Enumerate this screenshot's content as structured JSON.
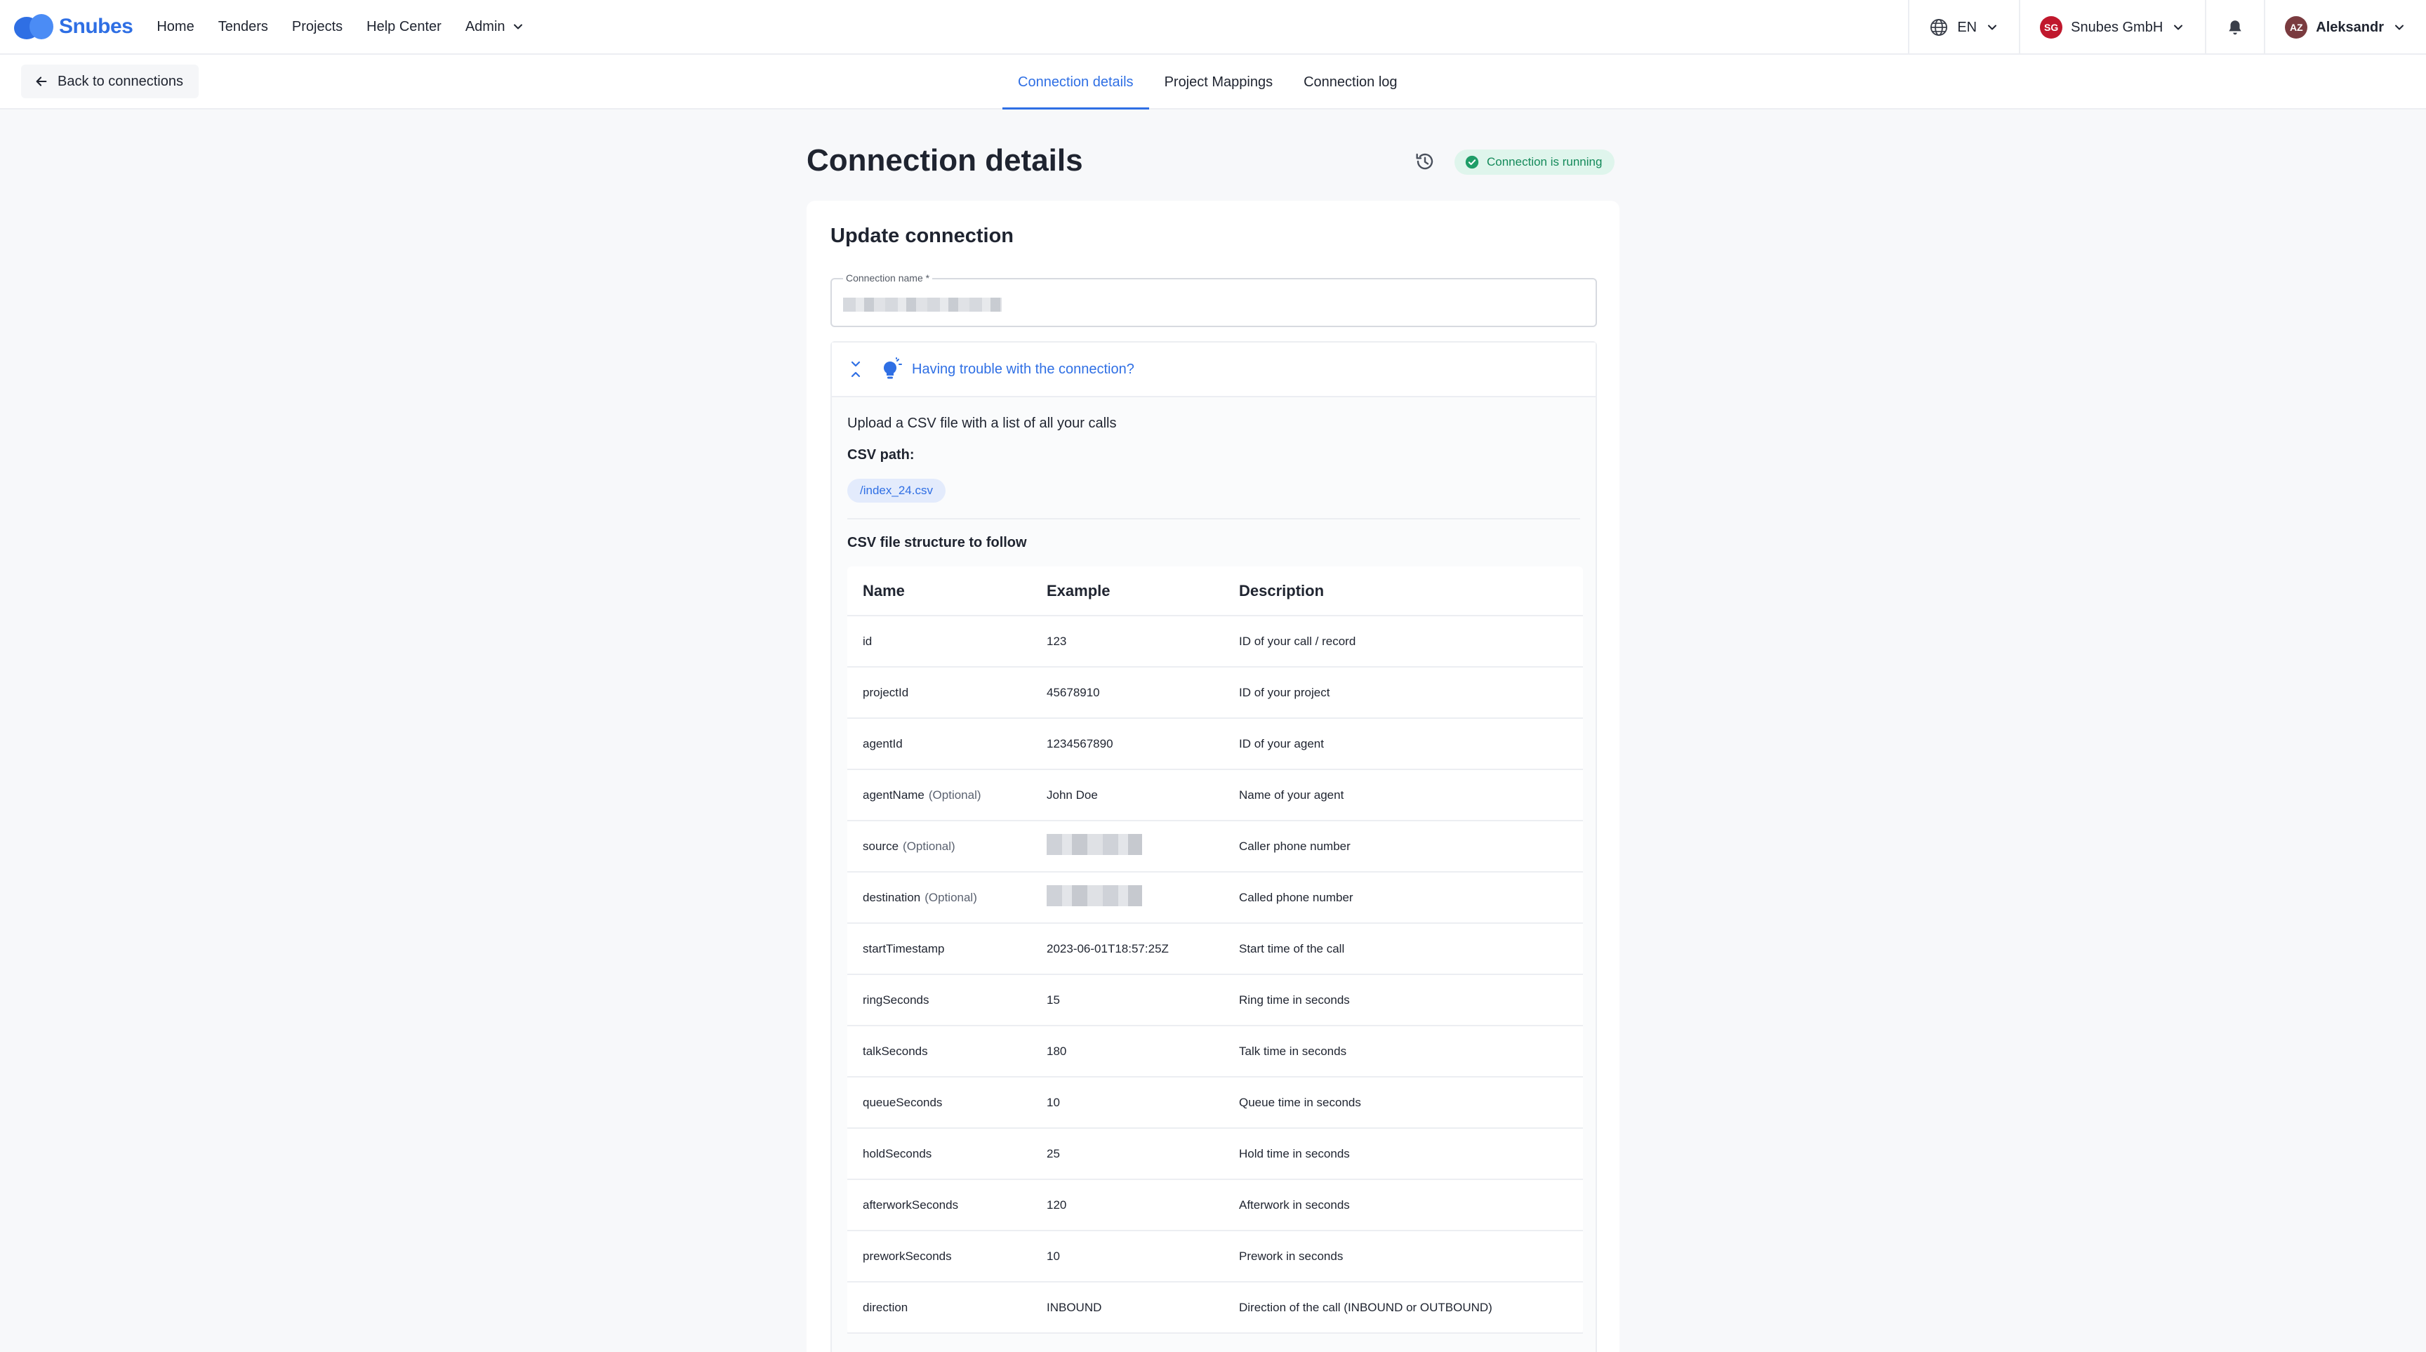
{
  "nav": {
    "brand": "Snubes",
    "links": [
      {
        "label": "Home"
      },
      {
        "label": "Tenders"
      },
      {
        "label": "Projects"
      },
      {
        "label": "Help Center"
      },
      {
        "label": "Admin"
      }
    ],
    "language": "EN",
    "company": {
      "initials": "SG",
      "name": "Snubes GmbH"
    },
    "user": {
      "initials": "AZ",
      "name": "Aleksandr"
    }
  },
  "subheader": {
    "back_label": "Back to connections",
    "tabs": [
      {
        "label": "Connection details",
        "active": true
      },
      {
        "label": "Project Mappings",
        "active": false
      },
      {
        "label": "Connection log",
        "active": false
      }
    ]
  },
  "page": {
    "title": "Connection details",
    "status": "Connection is running"
  },
  "form": {
    "title": "Update connection",
    "name_label": "Connection name *",
    "name_value": ""
  },
  "help": {
    "title": "Having trouble with the connection?",
    "upload_text": "Upload a CSV file with a list of all your calls",
    "csv_path_label": "CSV path:",
    "csv_path": "/index_24.csv",
    "structure_title": "CSV file structure to follow",
    "table": {
      "headers": [
        "Name",
        "Example",
        "Description"
      ],
      "optional_label": "(Optional)",
      "rows": [
        {
          "name": "id",
          "optional": false,
          "example": "123",
          "description": "ID of your call / record"
        },
        {
          "name": "projectId",
          "optional": false,
          "example": "45678910",
          "description": "ID of your project"
        },
        {
          "name": "agentId",
          "optional": false,
          "example": "1234567890",
          "description": "ID of your agent"
        },
        {
          "name": "agentName",
          "optional": true,
          "example": "John Doe",
          "description": "Name of your agent"
        },
        {
          "name": "source",
          "optional": true,
          "example": "",
          "description": "Caller phone number"
        },
        {
          "name": "destination",
          "optional": true,
          "example": "",
          "description": "Called phone number"
        },
        {
          "name": "startTimestamp",
          "optional": false,
          "example": "2023-06-01T18:57:25Z",
          "description": "Start time of the call"
        },
        {
          "name": "ringSeconds",
          "optional": false,
          "example": "15",
          "description": "Ring time in seconds"
        },
        {
          "name": "talkSeconds",
          "optional": false,
          "example": "180",
          "description": "Talk time in seconds"
        },
        {
          "name": "queueSeconds",
          "optional": false,
          "example": "10",
          "description": "Queue time in seconds"
        },
        {
          "name": "holdSeconds",
          "optional": false,
          "example": "25",
          "description": "Hold time in seconds"
        },
        {
          "name": "afterworkSeconds",
          "optional": false,
          "example": "120",
          "description": "Afterwork in seconds"
        },
        {
          "name": "preworkSeconds",
          "optional": false,
          "example": "10",
          "description": "Prework in seconds"
        },
        {
          "name": "direction",
          "optional": false,
          "example": "INBOUND",
          "description": "Direction of the call (INBOUND or OUTBOUND)"
        }
      ]
    }
  },
  "colors": {
    "accent": "#2f6fe4",
    "status_bg": "#dff5ec",
    "status_text": "#148a5a",
    "company_avatar": "#c0182d",
    "user_avatar": "#7a3b3f"
  },
  "icons": {
    "logo": "snubes-logo-icon",
    "globe": "globe-icon",
    "bell": "bell-icon",
    "chevron": "chevron-down-icon",
    "back": "arrow-left-icon",
    "history": "history-icon",
    "check": "check-circle-icon",
    "collapse": "collapse-icon",
    "bulb": "lightbulb-icon"
  }
}
